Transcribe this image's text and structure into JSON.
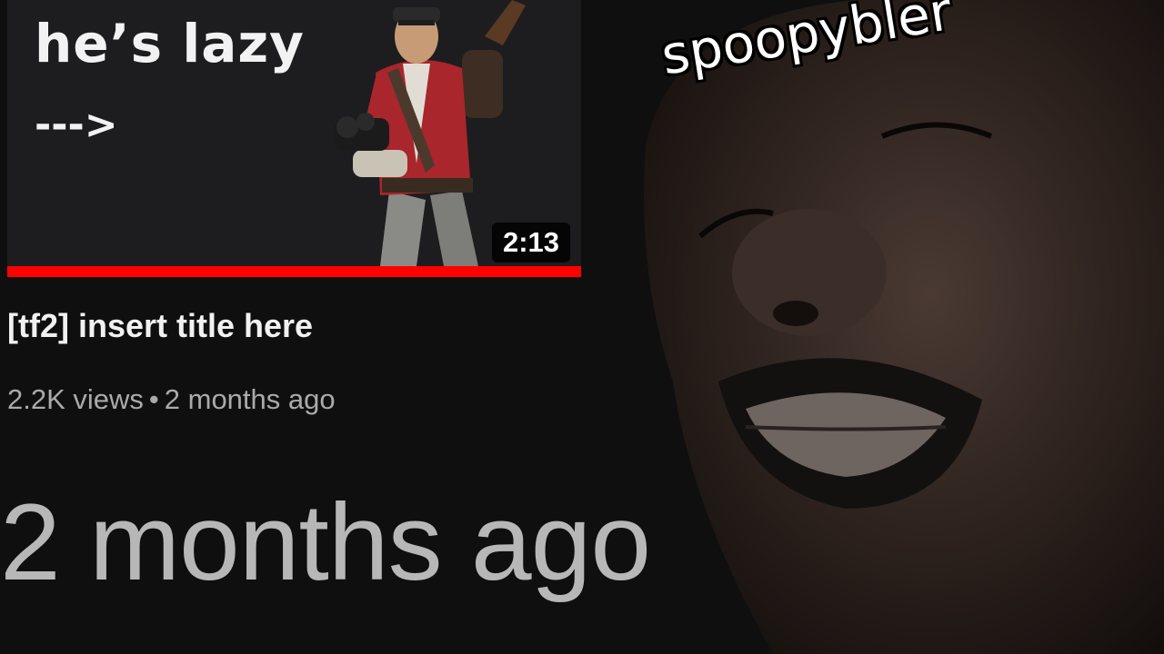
{
  "video": {
    "thumbnail_caption": "he’s lazy",
    "thumbnail_arrow": "--->",
    "duration": "2:13",
    "watch_progress": 1.0,
    "title": "[tf2] insert title here",
    "views": "2.2K views",
    "separator": "•",
    "age": "2 months ago"
  },
  "overlay": {
    "big_text": "2 months ago",
    "face_label": "spoopybler"
  },
  "colors": {
    "background": "#0f0f0f",
    "progress": "#ff0000",
    "title_text": "#f1f1f1",
    "meta_text": "#aaaaaa"
  }
}
